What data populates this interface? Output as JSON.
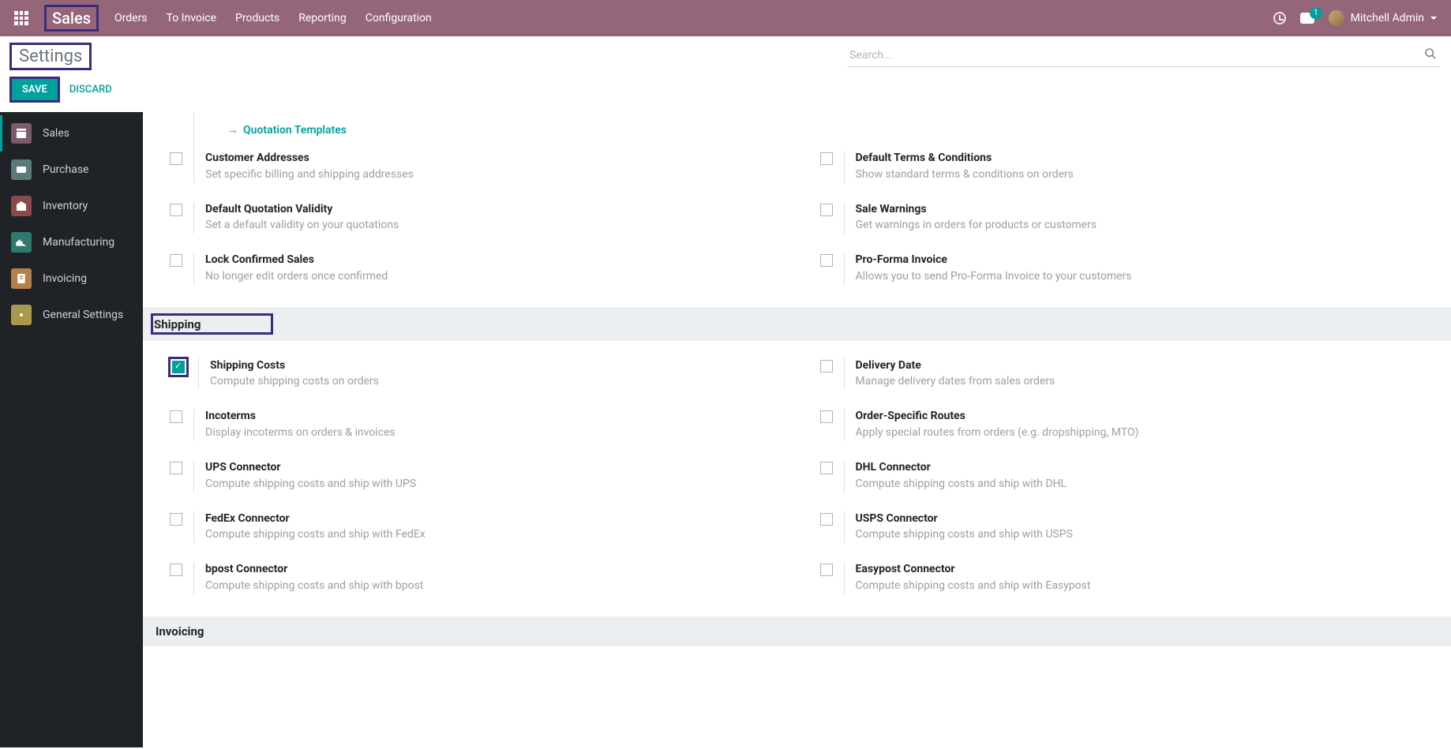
{
  "brand": "Sales",
  "nav": [
    "Orders",
    "To Invoice",
    "Products",
    "Reporting",
    "Configuration"
  ],
  "notif_count": "1",
  "user_name": "Mitchell Admin",
  "page_title": "Settings",
  "search_placeholder": "Search...",
  "btn_save": "SAVE",
  "btn_discard": "DISCARD",
  "sidebar": [
    {
      "label": "Sales"
    },
    {
      "label": "Purchase"
    },
    {
      "label": "Inventory"
    },
    {
      "label": "Manufacturing"
    },
    {
      "label": "Invoicing"
    },
    {
      "label": "General Settings"
    }
  ],
  "link_quotation": "Quotation Templates",
  "settings_top": [
    {
      "title": "Customer Addresses",
      "desc": "Set specific billing and shipping addresses"
    },
    {
      "title": "Default Terms & Conditions",
      "desc": "Show standard terms & conditions on orders"
    },
    {
      "title": "Default Quotation Validity",
      "desc": "Set a default validity on your quotations"
    },
    {
      "title": "Sale Warnings",
      "desc": "Get warnings in orders for products or customers"
    },
    {
      "title": "Lock Confirmed Sales",
      "desc": "No longer edit orders once confirmed"
    },
    {
      "title": "Pro-Forma Invoice",
      "desc": "Allows you to send Pro-Forma Invoice to your customers"
    }
  ],
  "section_shipping": "Shipping",
  "settings_shipping": [
    {
      "title": "Shipping Costs",
      "desc": "Compute shipping costs on orders",
      "checked": true
    },
    {
      "title": "Delivery Date",
      "desc": "Manage delivery dates from sales orders"
    },
    {
      "title": "Incoterms",
      "desc": "Display incoterms on orders & invoices"
    },
    {
      "title": "Order-Specific Routes",
      "desc": "Apply special routes from orders (e.g. dropshipping, MTO)"
    },
    {
      "title": "UPS Connector",
      "desc": "Compute shipping costs and ship with UPS"
    },
    {
      "title": "DHL Connector",
      "desc": "Compute shipping costs and ship with DHL"
    },
    {
      "title": "FedEx Connector",
      "desc": "Compute shipping costs and ship with FedEx"
    },
    {
      "title": "USPS Connector",
      "desc": "Compute shipping costs and ship with USPS"
    },
    {
      "title": "bpost Connector",
      "desc": "Compute shipping costs and ship with bpost"
    },
    {
      "title": "Easypost Connector",
      "desc": "Compute shipping costs and ship with Easypost"
    }
  ],
  "section_invoicing": "Invoicing"
}
